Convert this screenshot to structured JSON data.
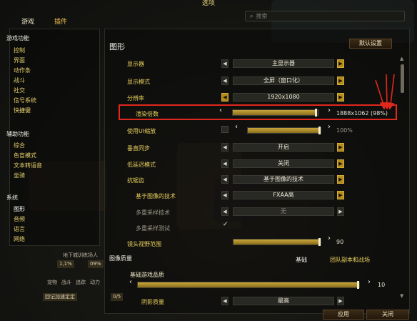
{
  "window": {
    "title": "选项"
  },
  "tabs": [
    {
      "label": "游戏"
    },
    {
      "label": "插件"
    }
  ],
  "search": {
    "placeholder": "搜索"
  },
  "sidebar": {
    "groups": [
      {
        "heading": "游戏功能",
        "items": [
          "控制",
          "界面",
          "动作条",
          "战斗",
          "社交",
          "信号系统",
          "快捷键"
        ]
      },
      {
        "heading": "辅助功能",
        "items": [
          "综合",
          "色盲模式",
          "文本转语音",
          "坐骑"
        ]
      },
      {
        "heading": "系统",
        "items": [
          "图形",
          "音频",
          "语言",
          "网络"
        ]
      }
    ]
  },
  "main": {
    "title": "图形",
    "default_button": "默认设置",
    "rows": {
      "monitor": {
        "label": "显示器",
        "value": "主显示器"
      },
      "display_mode": {
        "label": "显示模式",
        "value": "全屏（窗口化）"
      },
      "resolution": {
        "label": "分辨率",
        "value": "1920x1080"
      },
      "render_scale": {
        "label": "渲染倍数",
        "value": "1888x1062 (98%)",
        "fraction": 0.98
      },
      "ui_scale": {
        "label": "使用UI缩放",
        "value": "100%",
        "fraction": 1.0
      },
      "vsync": {
        "label": "垂直同步",
        "value": "开启"
      },
      "low_latency": {
        "label": "低延迟模式",
        "value": "关闭"
      },
      "antialias": {
        "label": "抗锯齿",
        "value": "基于图像的技术"
      },
      "image_tech": {
        "label": "基于图像的技术",
        "value": "FXAA高"
      },
      "multisample": {
        "label": "多重采样技术",
        "value": "无"
      },
      "multisample_test": {
        "label": "多重采样测试"
      },
      "fov": {
        "label": "镜头视野范围",
        "value": "90",
        "fraction": 1.0
      }
    },
    "quality_tabs": {
      "label": "图像质量",
      "base": "基础",
      "raid": "团队副本和战场"
    },
    "base_quality": {
      "label": "基础游戏品质",
      "value": "10",
      "fraction": 1.0
    },
    "shadow_quality": {
      "label": "阴影质量",
      "value": "最高"
    }
  },
  "footer": {
    "apply": "应用",
    "close": "关闭"
  },
  "background": {
    "texts": [
      "地下城训练场人",
      "1,1%",
      "09%",
      "宠物",
      "战斗",
      "追踪",
      "动力",
      "回记加速定定"
    ],
    "counter": "0/5"
  },
  "colors": {
    "accent": "#e8cf5c",
    "highlight": "#e0281e",
    "slider_fill": "#c9a53c"
  }
}
